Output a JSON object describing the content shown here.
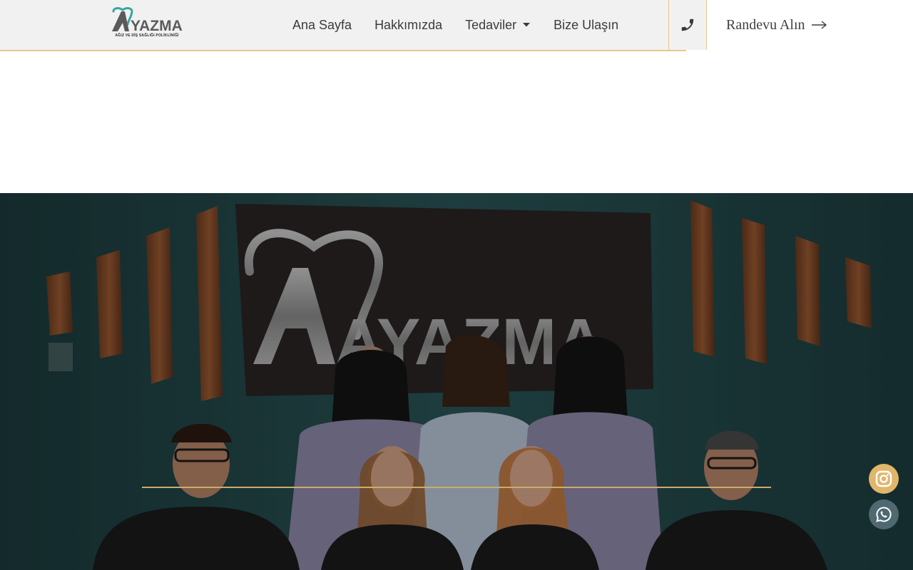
{
  "brand": {
    "name": "AYAZMA",
    "subtitle": "AĞIZ VE DİŞ SAĞLIĞI POLİKLİNİĞİ",
    "accent_color": "#e6c98e",
    "logo_teal": "#3aa6a0"
  },
  "nav": {
    "items": [
      {
        "label": "Ana Sayfa"
      },
      {
        "label": "Hakkımızda"
      },
      {
        "label": "Tedaviler",
        "has_dropdown": true,
        "icon": "caret-down-icon"
      },
      {
        "label": "Bize Ulaşın"
      }
    ]
  },
  "header": {
    "phone_icon": "phone-icon",
    "cta_label": "Randevu Alın",
    "cta_icon": "arrow-right-icon"
  },
  "hero": {
    "sign_text": "AYAZMA",
    "image_description_icon": "team-photo"
  },
  "floating": {
    "instagram_icon": "instagram-icon",
    "instagram_color": "#e0b66a",
    "whatsapp_icon": "whatsapp-icon",
    "whatsapp_color": "#4f6970"
  }
}
